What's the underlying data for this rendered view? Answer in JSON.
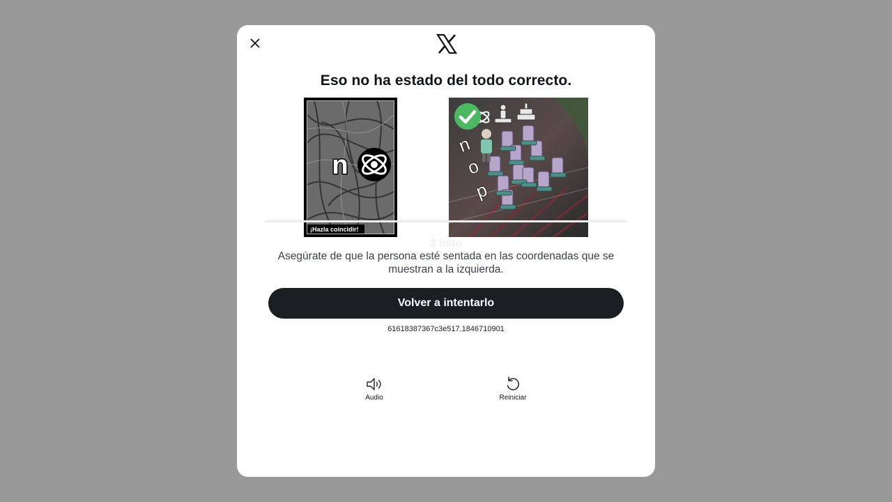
{
  "dialog": {
    "title": "Eso no ha estado del todo correcto.",
    "close_icon": "close-icon",
    "logo_icon": "x-logo-icon"
  },
  "challenge": {
    "left_image": {
      "letter": "n",
      "icon": "atom-icon",
      "caption": "¡Hazla coincidir!"
    },
    "right_image": {
      "letters": [
        "n",
        "o",
        "p"
      ],
      "icons": [
        "atom-icon",
        "stamp-icon",
        "cake-icon"
      ],
      "status_icon": "green-checkmark-icon"
    },
    "hidden_status": "3 listo",
    "instructions": "Asegúrate de que la persona esté sentada en las coordenadas que se muestran a la izquierda."
  },
  "actions": {
    "retry_label": "Volver a intentarlo",
    "session_id": "61618387367c3e517.1846710901",
    "audio_label": "Audio",
    "restart_label": "Reiniciar"
  },
  "colors": {
    "backdrop": "#999999",
    "button": "#1a1f24",
    "check": "#4cb862"
  }
}
